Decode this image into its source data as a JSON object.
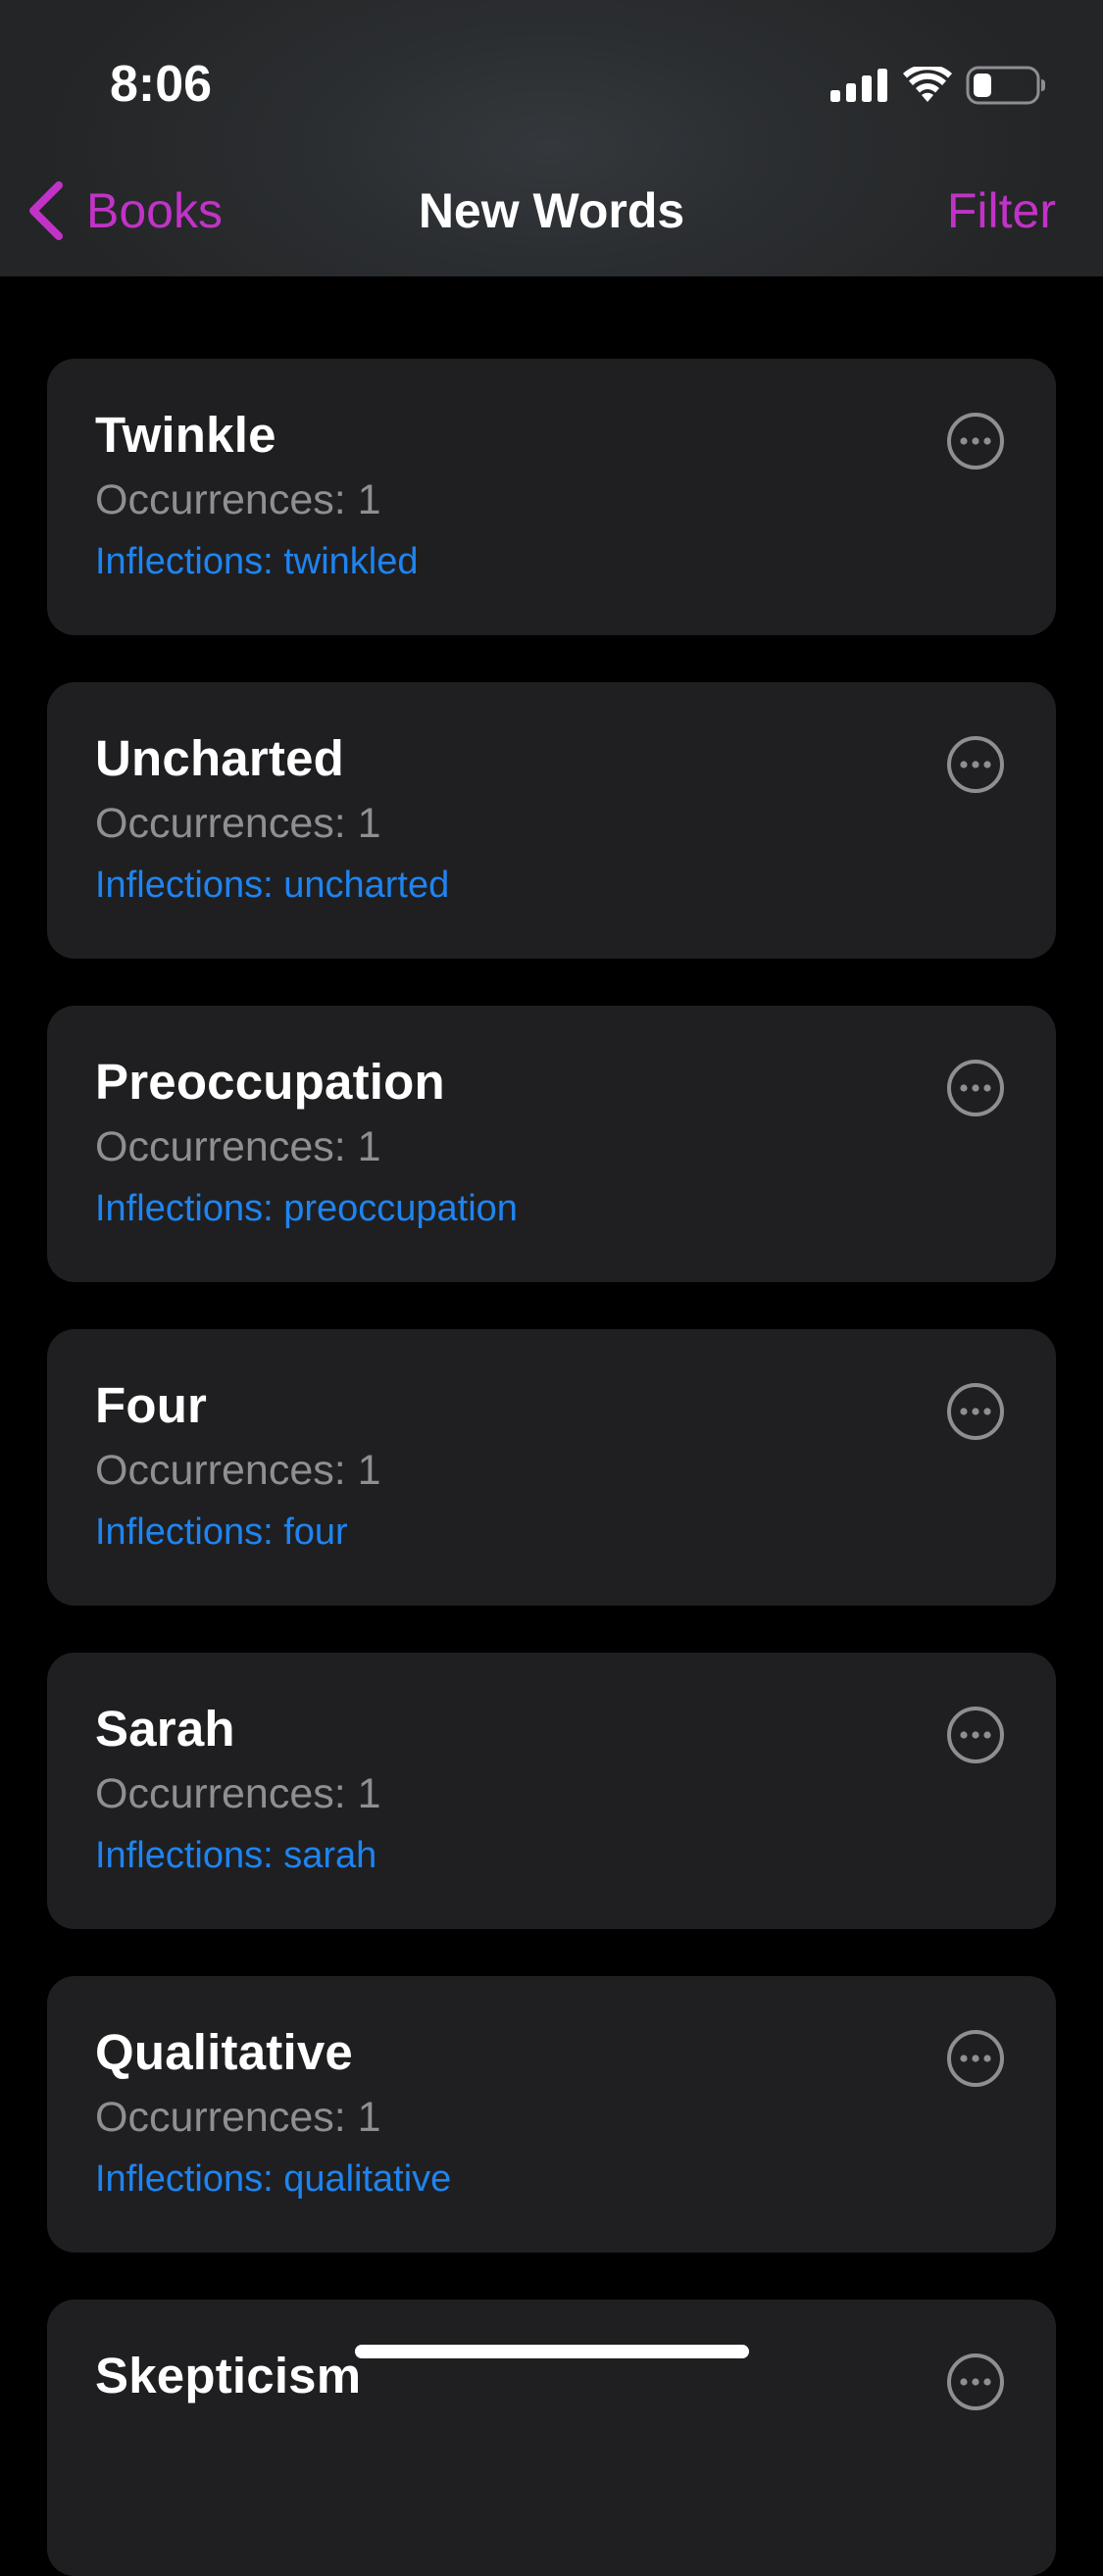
{
  "status_bar": {
    "time": "8:06"
  },
  "nav": {
    "back_label": "Books",
    "title": "New Words",
    "filter_label": "Filter"
  },
  "colors": {
    "accent": "#c133c7",
    "link": "#1f84f0",
    "card": "#1f1f21",
    "secondary_text": "#8e8e93"
  },
  "words": [
    {
      "title": "Twinkle",
      "occurrences": "Occurrences: 1",
      "inflections": "Inflections: twinkled"
    },
    {
      "title": "Uncharted",
      "occurrences": "Occurrences: 1",
      "inflections": "Inflections: uncharted"
    },
    {
      "title": "Preoccupation",
      "occurrences": "Occurrences: 1",
      "inflections": "Inflections: preoccupation"
    },
    {
      "title": "Four",
      "occurrences": "Occurrences: 1",
      "inflections": "Inflections: four"
    },
    {
      "title": "Sarah",
      "occurrences": "Occurrences: 1",
      "inflections": "Inflections: sarah"
    },
    {
      "title": "Qualitative",
      "occurrences": "Occurrences: 1",
      "inflections": "Inflections: qualitative"
    },
    {
      "title": "Skepticism"
    }
  ],
  "icons": {
    "more": "ellipsis-circle-icon",
    "back": "chevron-left-icon",
    "signal": "cellular-signal-icon",
    "wifi": "wifi-icon",
    "battery": "battery-icon"
  }
}
